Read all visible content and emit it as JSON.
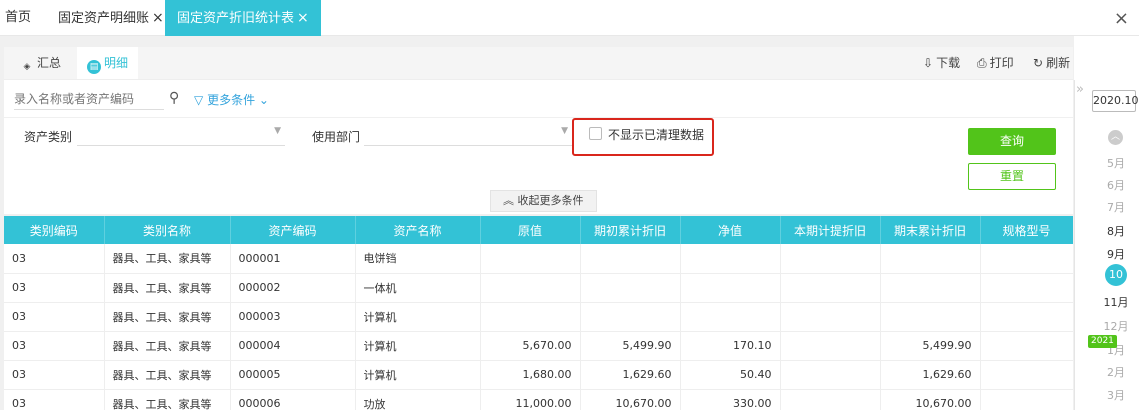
{
  "top_tabs": [
    {
      "label": "首页",
      "closable": false
    },
    {
      "label": "固定资产明细账",
      "closable": true
    },
    {
      "label": "固定资产折旧统计表",
      "closable": true,
      "active": true
    }
  ],
  "close_glyph": "×",
  "sub_tabs": [
    {
      "label": "汇总",
      "icon": "layers-icon"
    },
    {
      "label": "明细",
      "icon": "detail-icon",
      "active": true
    }
  ],
  "toolbar": {
    "download": "下载",
    "print": "打印",
    "refresh": "刷新"
  },
  "search": {
    "placeholder": "录入名称或者资产编码",
    "more_conditions": "更多条件"
  },
  "filters": {
    "asset_category_label": "资产类别",
    "department_label": "使用部门",
    "hide_cleared_label": "不显示已清理数据",
    "query_button": "查询",
    "reset_button": "重置",
    "collapse_label": "收起更多条件"
  },
  "table": {
    "columns": [
      "类别编码",
      "类别名称",
      "资产编码",
      "资产名称",
      "原值",
      "期初累计折旧",
      "净值",
      "本期计提折旧",
      "期末累计折旧",
      "规格型号"
    ],
    "rows": [
      [
        "03",
        "器具、工具、家具等",
        "000001",
        "电饼铛",
        "",
        "",
        "",
        "",
        "",
        ""
      ],
      [
        "03",
        "器具、工具、家具等",
        "000002",
        "一体机",
        "",
        "",
        "",
        "",
        "",
        ""
      ],
      [
        "03",
        "器具、工具、家具等",
        "000003",
        "计算机",
        "",
        "",
        "",
        "",
        "",
        ""
      ],
      [
        "03",
        "器具、工具、家具等",
        "000004",
        "计算机",
        "5,670.00",
        "5,499.90",
        "170.10",
        "",
        "5,499.90",
        ""
      ],
      [
        "03",
        "器具、工具、家具等",
        "000005",
        "计算机",
        "1,680.00",
        "1,629.60",
        "50.40",
        "",
        "1,629.60",
        ""
      ],
      [
        "03",
        "器具、工具、家具等",
        "000006",
        "功放",
        "11,000.00",
        "10,670.00",
        "330.00",
        "",
        "10,670.00",
        ""
      ]
    ]
  },
  "sidebar": {
    "current_period": "2020.10",
    "months": [
      "5月",
      "6月",
      "7月",
      "8月",
      "9月",
      "10月",
      "11月",
      "12月",
      "1月",
      "2月",
      "3月"
    ],
    "year_badge": "2021",
    "current_index": 5,
    "strong_indices": [
      3,
      4,
      6
    ]
  }
}
